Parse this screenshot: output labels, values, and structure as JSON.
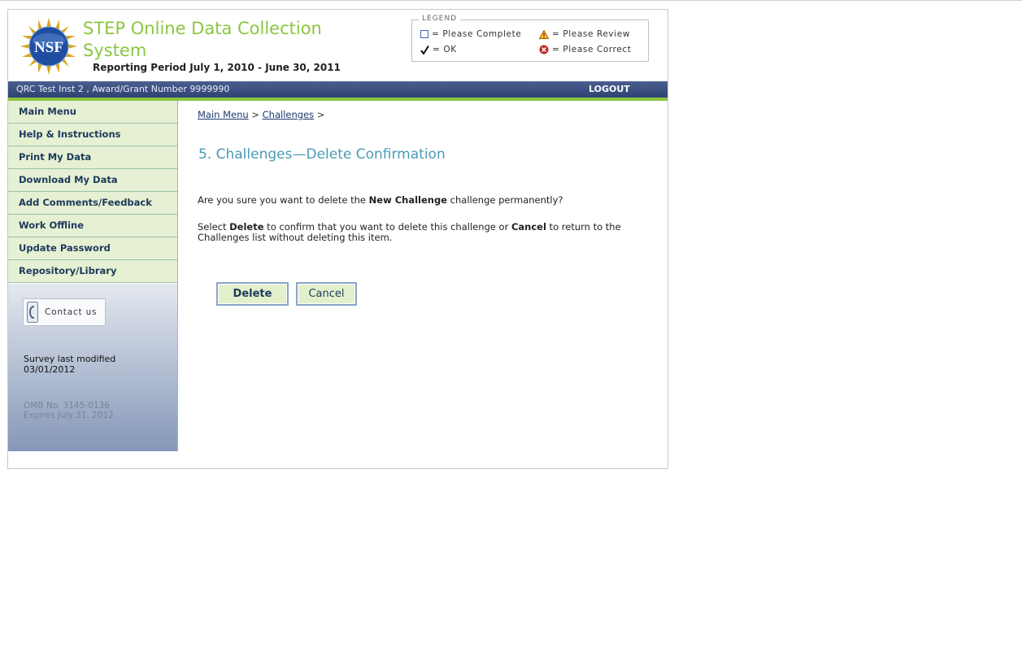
{
  "header": {
    "title": "STEP Online Data Collection System",
    "reporting_period": "Reporting Period July 1, 2010 - June 30, 2011",
    "logo_text": "NSF"
  },
  "legend": {
    "title": "LEGEND",
    "please_complete": "= Please Complete",
    "please_review": "= Please Review",
    "ok": "= OK",
    "please_correct": "= Please Correct"
  },
  "bar": {
    "institution": "QRC Test Inst 2 , Award/Grant Number 9999990",
    "logout": "LOGOUT"
  },
  "sidebar": {
    "items": [
      {
        "label": "Main Menu"
      },
      {
        "label": "Help & Instructions"
      },
      {
        "label": "Print My Data"
      },
      {
        "label": "Download My Data"
      },
      {
        "label": "Add Comments/Feedback"
      },
      {
        "label": "Work Offline"
      },
      {
        "label": "Update Password"
      },
      {
        "label": "Repository/Library"
      }
    ],
    "contact": "Contact us",
    "survey_modified_label": "Survey last modified",
    "survey_modified_date": "03/01/2012",
    "omb": "OMB No. 3145-0136",
    "expires": "Expires July 31, 2012"
  },
  "main": {
    "breadcrumb": {
      "item1": "Main Menu",
      "item2": "Challenges",
      "sep": ">"
    },
    "title": "5. Challenges—Delete Confirmation",
    "confirm": {
      "pre": "Are you sure you want to delete the ",
      "name": "New Challenge",
      "post": " challenge permanently?"
    },
    "instructions": {
      "pre": "Select ",
      "delete_word": "Delete",
      "mid": " to confirm that you want to delete this challenge or ",
      "cancel_word": "Cancel",
      "post": " to return to the Challenges list without deleting this item."
    },
    "delete_button": "Delete",
    "cancel_button": "Cancel"
  },
  "colors": {
    "title_green": "#8cc63f",
    "bar_blue": "#2f4373",
    "heading_teal": "#4a9bb5",
    "nav_bg": "#e6f0d3"
  }
}
